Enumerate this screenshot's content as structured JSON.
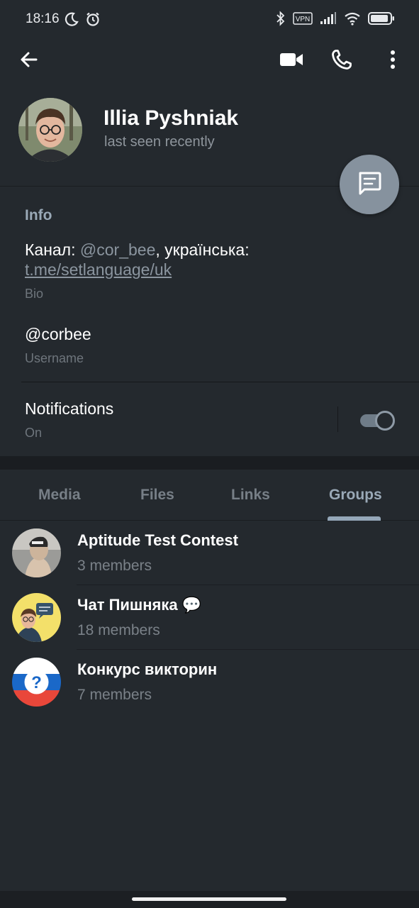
{
  "status_bar": {
    "time": "18:16",
    "left_icons": [
      "moon-icon",
      "alarm-icon"
    ],
    "right_icons": [
      "bluetooth-icon",
      "vpn-icon",
      "signal-icon",
      "wifi-icon",
      "battery-icon"
    ],
    "vpn_label": "VPN"
  },
  "toolbar": {
    "back_icon": "arrow-left-icon",
    "video_icon": "video-camera-icon",
    "call_icon": "phone-icon",
    "more_icon": "more-vertical-icon"
  },
  "profile": {
    "name": "Illia Pyshniak",
    "status": "last seen recently",
    "fab_icon": "message-icon"
  },
  "info": {
    "title": "Info",
    "bio_prefix": "Канал: ",
    "bio_channel": "@cor_bee",
    "bio_middle": ", українська: ",
    "bio_link": "t.me/setlanguage/uk",
    "bio_label": "Bio",
    "username": "@corbee",
    "username_label": "Username",
    "notifications_label": "Notifications",
    "notifications_state": "On",
    "notifications_enabled": true
  },
  "tabs": [
    {
      "label": "Media",
      "active": false
    },
    {
      "label": "Files",
      "active": false
    },
    {
      "label": "Links",
      "active": false
    },
    {
      "label": "Groups",
      "active": true
    }
  ],
  "groups": [
    {
      "name": "Aptitude Test Contest",
      "members": "3 members",
      "avatar_icon": "sculpture-photo-avatar"
    },
    {
      "name": "Чат Пишняка",
      "name_emoji": "💬",
      "members": "18 members",
      "avatar_icon": "person-chat-avatar"
    },
    {
      "name": "Конкурс викторин",
      "members": "7 members",
      "avatar_icon": "question-flag-avatar"
    }
  ],
  "colors": {
    "background": "#1c1f23",
    "panel": "#24292e",
    "accent": "#9aa9b7",
    "fab": "#86929e",
    "muted_text": "#7a8188"
  }
}
